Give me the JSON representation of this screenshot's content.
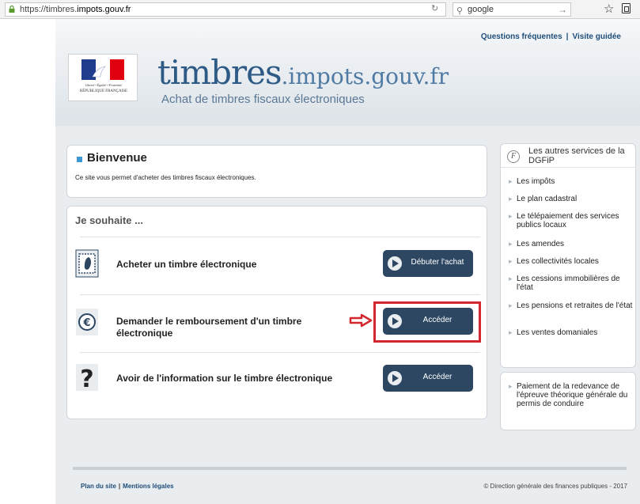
{
  "browser": {
    "url_prefix": "https://timbres.",
    "url_host": "impots.gouv.fr",
    "search_value": "google"
  },
  "header": {
    "links": [
      "Questions fréquentes",
      "Visite guidée"
    ],
    "link_separator": "|",
    "title_main": "timbres",
    "title_domain": ".impots.gouv.fr",
    "subtitle": "Achat de timbres fiscaux électroniques",
    "logo_motto": "Liberté • Égalité • Fraternité",
    "logo_republic": "RÉPUBLIQUE FRANÇAISE"
  },
  "welcome": {
    "title": "Bienvenue",
    "text": "Ce site vous permet d'acheter des timbres fiscaux électroniques."
  },
  "wish": {
    "title": "Je souhaite ...",
    "rows": [
      {
        "text": "Acheter un timbre électronique",
        "button": "Débuter l'achat",
        "icon": "stamp-icon"
      },
      {
        "text": "Demander le remboursement d'un timbre électronique",
        "button": "Accéder",
        "icon": "euro-icon"
      },
      {
        "text": "Avoir de l'information sur le timbre électronique",
        "button": "Accéder",
        "icon": "question-icon"
      }
    ]
  },
  "sidebar": {
    "title": "Les autres services de la DGFiP",
    "items": [
      "Les impôts",
      "Le plan cadastral",
      "Le télépaiement des services publics locaux",
      "Les amendes",
      "Les collectivités locales",
      "Les cessions immobilières de l'état",
      "Les pensions et retraites de l'état",
      "Les ventes domaniales"
    ],
    "extra_item": "Paiement de la redevance de l'épreuve théorique générale du permis de conduire"
  },
  "footer": {
    "left_links": [
      "Plan du site",
      "Mentions légales"
    ],
    "separator": "|",
    "copyright": "© Direction générale des finances publiques - 2017"
  },
  "colors": {
    "accent": "#3c97d5",
    "button": "#2d4762",
    "highlight": "#d4262e",
    "title": "#2d5b86"
  }
}
